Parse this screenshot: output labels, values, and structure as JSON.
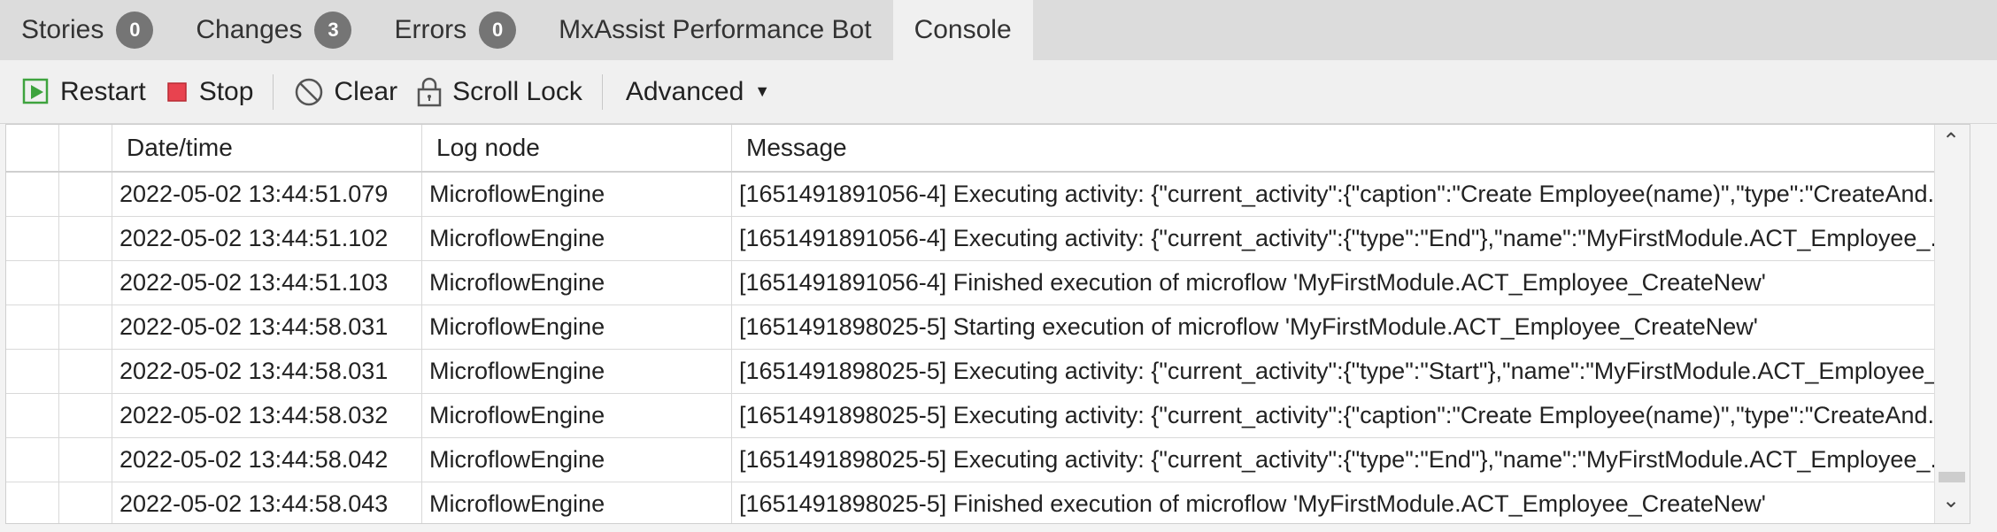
{
  "tabs": [
    {
      "label": "Stories",
      "badge": "0"
    },
    {
      "label": "Changes",
      "badge": "3"
    },
    {
      "label": "Errors",
      "badge": "0"
    },
    {
      "label": "MxAssist Performance Bot"
    },
    {
      "label": "Console",
      "active": true
    }
  ],
  "toolbar": {
    "restart": "Restart",
    "stop": "Stop",
    "clear": "Clear",
    "scroll_lock": "Scroll Lock",
    "advanced": "Advanced",
    "advanced_caret": "▼"
  },
  "table": {
    "columns": [
      "",
      "",
      "Date/time",
      "Log node",
      "Message"
    ],
    "rows": [
      {
        "datetime": "2022-05-02 13:44:51.079",
        "node": "MicroflowEngine",
        "message": "[1651491891056-4] Executing activity: {\"current_activity\":{\"caption\":\"Create Employee(name)\",\"type\":\"CreateAnd..."
      },
      {
        "datetime": "2022-05-02 13:44:51.102",
        "node": "MicroflowEngine",
        "message": "[1651491891056-4] Executing activity: {\"current_activity\":{\"type\":\"End\"},\"name\":\"MyFirstModule.ACT_Employee_..."
      },
      {
        "datetime": "2022-05-02 13:44:51.103",
        "node": "MicroflowEngine",
        "message": "[1651491891056-4] Finished execution of microflow 'MyFirstModule.ACT_Employee_CreateNew'"
      },
      {
        "datetime": "2022-05-02 13:44:58.031",
        "node": "MicroflowEngine",
        "message": "[1651491898025-5] Starting execution of microflow 'MyFirstModule.ACT_Employee_CreateNew'"
      },
      {
        "datetime": "2022-05-02 13:44:58.031",
        "node": "MicroflowEngine",
        "message": "[1651491898025-5] Executing activity: {\"current_activity\":{\"type\":\"Start\"},\"name\":\"MyFirstModule.ACT_Employee_..."
      },
      {
        "datetime": "2022-05-02 13:44:58.032",
        "node": "MicroflowEngine",
        "message": "[1651491898025-5] Executing activity: {\"current_activity\":{\"caption\":\"Create Employee(name)\",\"type\":\"CreateAnd..."
      },
      {
        "datetime": "2022-05-02 13:44:58.042",
        "node": "MicroflowEngine",
        "message": "[1651491898025-5] Executing activity: {\"current_activity\":{\"type\":\"End\"},\"name\":\"MyFirstModule.ACT_Employee_..."
      },
      {
        "datetime": "2022-05-02 13:44:58.043",
        "node": "MicroflowEngine",
        "message": "[1651491898025-5] Finished execution of microflow 'MyFirstModule.ACT_Employee_CreateNew'"
      }
    ]
  },
  "scrollbar": {
    "up": "⌃",
    "down": "⌄"
  },
  "icons": {
    "restart": "restart-icon",
    "stop": "stop-icon",
    "clear": "clear-icon",
    "scroll_lock": "lock-icon"
  },
  "colors": {
    "restart_green": "#3ea33e",
    "stop_red": "#e8434f",
    "badge_bg": "#757575",
    "tabbar_bg": "#dcdcdc"
  }
}
